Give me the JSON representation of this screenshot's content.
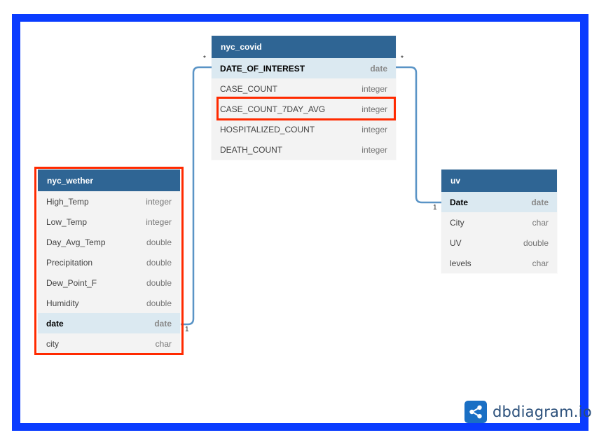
{
  "tables": {
    "nyc_covid": {
      "name": "nyc_covid",
      "rows": [
        {
          "name": "DATE_OF_INTEREST",
          "type": "date"
        },
        {
          "name": "CASE_COUNT",
          "type": "integer"
        },
        {
          "name": "CASE_COUNT_7DAY_AVG",
          "type": "integer"
        },
        {
          "name": "HOSPITALIZED_COUNT",
          "type": "integer"
        },
        {
          "name": "DEATH_COUNT",
          "type": "integer"
        }
      ]
    },
    "nyc_wether": {
      "name": "nyc_wether",
      "rows": [
        {
          "name": "High_Temp",
          "type": "integer"
        },
        {
          "name": "Low_Temp",
          "type": "integer"
        },
        {
          "name": "Day_Avg_Temp",
          "type": "double"
        },
        {
          "name": "Precipitation",
          "type": "double"
        },
        {
          "name": "Dew_Point_F",
          "type": "double"
        },
        {
          "name": "Humidity",
          "type": "double"
        },
        {
          "name": "date",
          "type": "date"
        },
        {
          "name": "city",
          "type": "char"
        }
      ]
    },
    "uv": {
      "name": "uv",
      "rows": [
        {
          "name": "Date",
          "type": "date"
        },
        {
          "name": "City",
          "type": "char"
        },
        {
          "name": "UV",
          "type": "double"
        },
        {
          "name": "levels",
          "type": "char"
        }
      ]
    }
  },
  "relations": {
    "covid_weather": {
      "covid_end": "*",
      "weather_end": "1"
    },
    "covid_uv": {
      "covid_end": "*",
      "uv_end": "1"
    }
  },
  "brand": {
    "name": "dbdiagram.io",
    "icon": "share-nodes-icon"
  },
  "colors": {
    "border": "#0a3cff",
    "header": "#2f6594",
    "highlight": "#ff2a00",
    "link": "#5a94c6"
  }
}
